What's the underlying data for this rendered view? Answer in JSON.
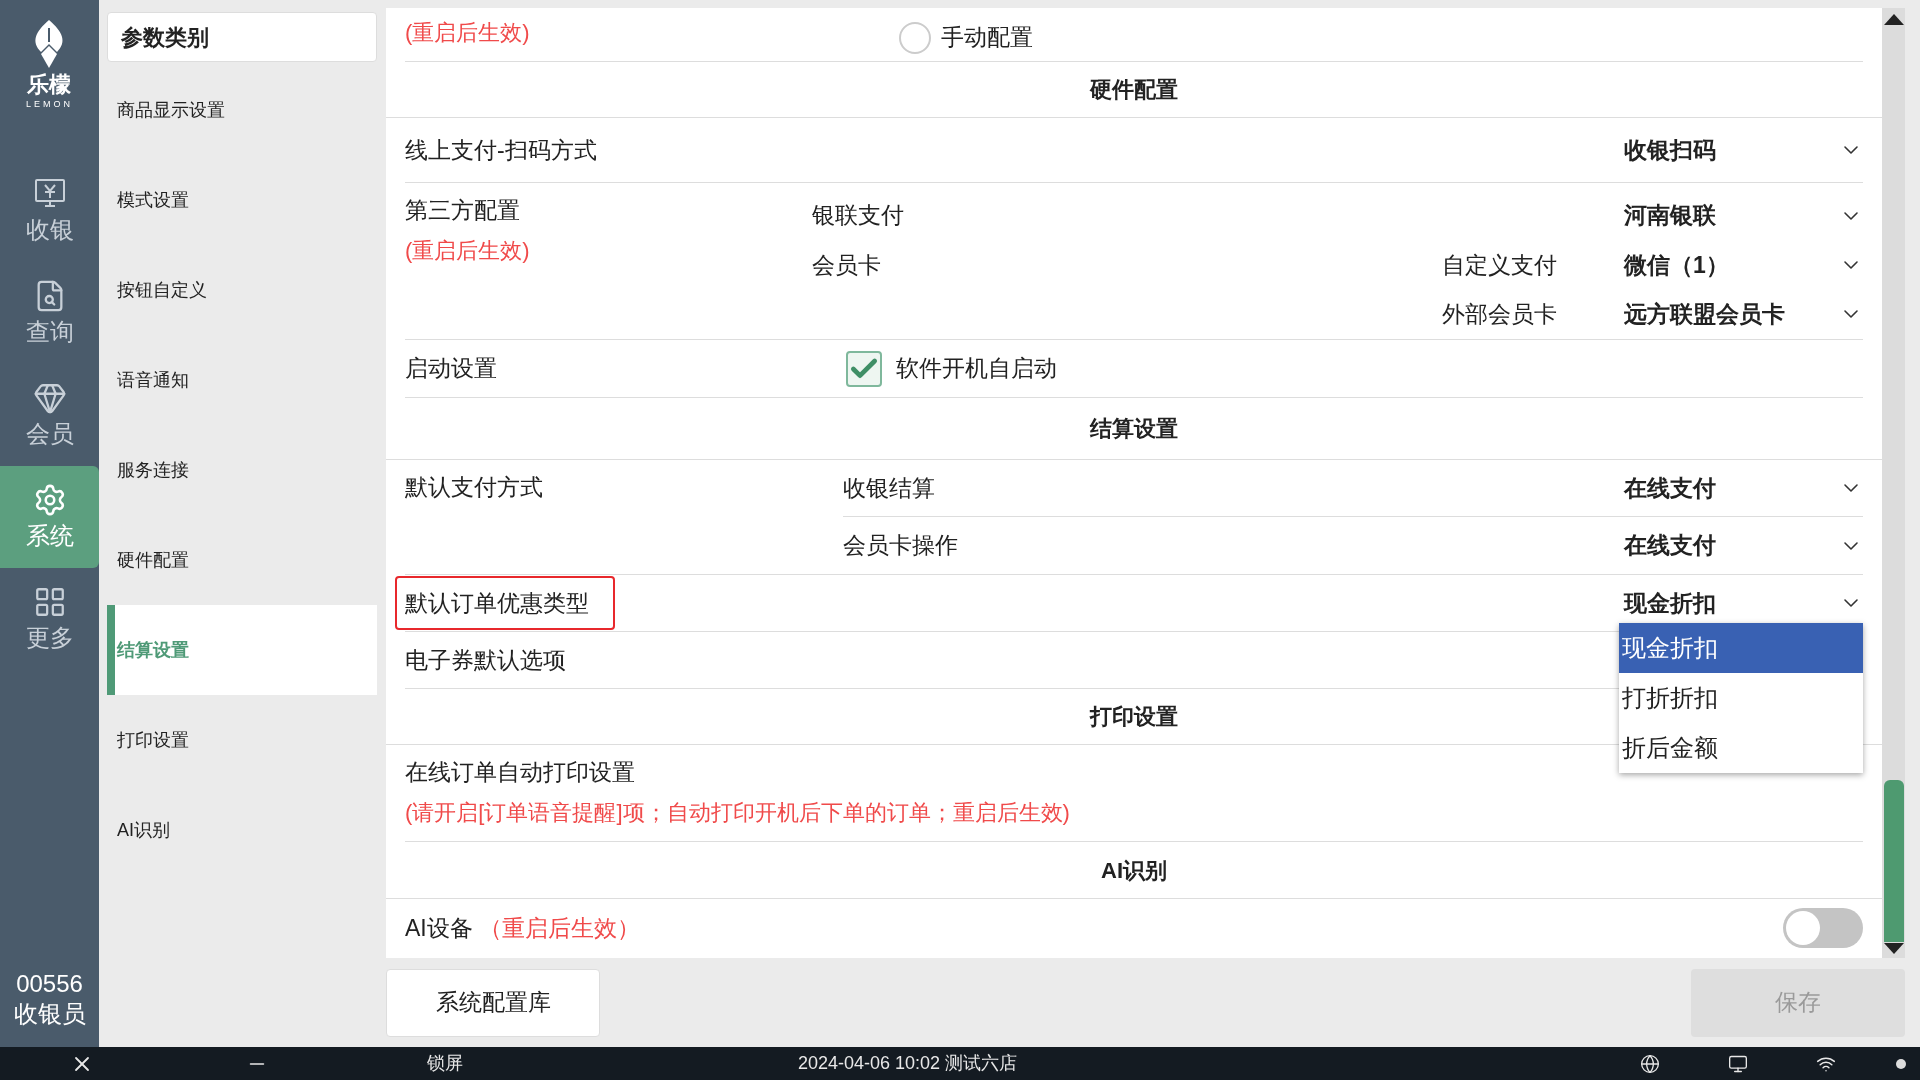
{
  "sidebar": {
    "logo_text": "乐檬",
    "logo_sub": "LEMON",
    "items": [
      {
        "label": "收银",
        "selected": false
      },
      {
        "label": "查询",
        "selected": false
      },
      {
        "label": "会员",
        "selected": false
      },
      {
        "label": "系统",
        "selected": true
      },
      {
        "label": "更多",
        "selected": false
      }
    ],
    "user_id": "00556",
    "user_role": "收银员"
  },
  "categories": {
    "title": "参数类别",
    "items": [
      {
        "label": "商品显示设置",
        "selected": false
      },
      {
        "label": "模式设置",
        "selected": false
      },
      {
        "label": "按钮自定义",
        "selected": false
      },
      {
        "label": "语音通知",
        "selected": false
      },
      {
        "label": "服务连接",
        "selected": false
      },
      {
        "label": "硬件配置",
        "selected": false
      },
      {
        "label": "结算设置",
        "selected": true
      },
      {
        "label": "打印设置",
        "selected": false
      },
      {
        "label": "AI识别",
        "selected": false
      }
    ]
  },
  "settings": [
    {
      "kind": "radio",
      "note": "(重启后生效)",
      "option": {
        "label": "手动配置",
        "selected": false
      }
    },
    {
      "kind": "header",
      "title": "硬件配置"
    },
    {
      "kind": "select",
      "label": "线上支付-扫码方式",
      "value": "收银扫码"
    },
    {
      "kind": "group",
      "label": "第三方配置",
      "note": "(重启后生效)",
      "divided": false,
      "items": [
        {
          "label": "银联支付",
          "value": "河南银联"
        },
        {
          "label": "会员卡",
          "sublabel": "自定义支付",
          "value": "微信（1）"
        },
        {
          "sublabel": "外部会员卡",
          "value": "远方联盟会员卡"
        }
      ]
    },
    {
      "kind": "checkbox",
      "label": "启动设置",
      "option": {
        "label": "软件开机自启动",
        "checked": true
      }
    },
    {
      "kind": "header",
      "title": "结算设置"
    },
    {
      "kind": "group",
      "label": "默认支付方式",
      "divided": true,
      "items": [
        {
          "label": "收银结算",
          "value": "在线支付"
        },
        {
          "label": "会员卡操作",
          "value": "在线支付"
        }
      ]
    },
    {
      "kind": "select",
      "label": "默认订单优惠类型",
      "highlighted": true,
      "value": "现金折扣",
      "expanded": true,
      "options": [
        {
          "label": "现金折扣",
          "selected": true
        },
        {
          "label": "打折折扣",
          "selected": false
        },
        {
          "label": "折后金额",
          "selected": false
        }
      ]
    },
    {
      "kind": "select",
      "label": "电子券默认选项"
    },
    {
      "kind": "header",
      "title": "打印设置"
    },
    {
      "kind": "select",
      "label": "在线订单自动打印设置",
      "note": "(请开启[订单语音提醒]项；自动打印开机后下单的订单；重启后生效)"
    },
    {
      "kind": "header",
      "title": "AI识别"
    },
    {
      "kind": "toggle",
      "label": "AI设备",
      "note": "（重启后生效）",
      "on": false
    }
  ],
  "footer": {
    "library_button": "系统配置库",
    "save_button": {
      "label": "保存",
      "disabled": true
    }
  },
  "taskbar": {
    "lock": "锁屏",
    "status": "2024-04-06 10:02 测试六店"
  }
}
